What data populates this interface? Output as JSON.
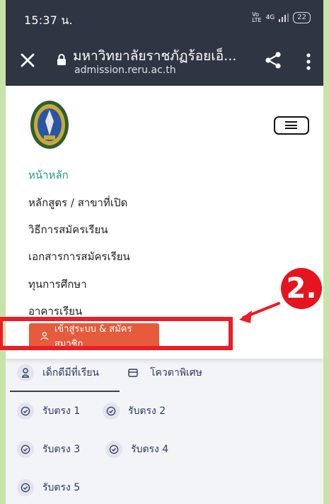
{
  "status": {
    "time": "15:37 น.",
    "signal": "4G",
    "battery": "22"
  },
  "browser": {
    "title": "มหาวิทยาลัยราชภัฏร้อยเอ็...",
    "url": "admission.reru.ac.th"
  },
  "nav": [
    {
      "label": "หน้าหลัก",
      "active": true
    },
    {
      "label": "หลักสูตร / สาขาที่เปิด"
    },
    {
      "label": "วิธีการสมัครเรียน"
    },
    {
      "label": "เอกสารการสมัครเรียน"
    },
    {
      "label": "ทุนการศึกษา"
    },
    {
      "label": "อาคารเรียน"
    }
  ],
  "login_button": "เข้าสู่ระบบ & สมัครสมาชิก",
  "annotation": {
    "step": "2."
  },
  "categories": [
    {
      "label": "เด็กดีมีที่เรียน",
      "icon": "person-badge-icon"
    },
    {
      "label": "โควตาพิเศษ",
      "icon": "card-icon"
    },
    {
      "label": "รับตรง 1",
      "icon": "check-circle-icon"
    },
    {
      "label": "รับตรง 2",
      "icon": "check-circle-icon"
    },
    {
      "label": "รับตรง 3",
      "icon": "check-circle-icon"
    },
    {
      "label": "รับตรง 4",
      "icon": "check-circle-icon"
    },
    {
      "label": "รับตรง 5",
      "icon": "check-circle-icon"
    }
  ],
  "colors": {
    "toolbar": "#2f3542",
    "accent": "#1f9b8a",
    "button": "#e65b3c",
    "highlight": "#ee1c25",
    "frame": "#c8e3a8"
  }
}
